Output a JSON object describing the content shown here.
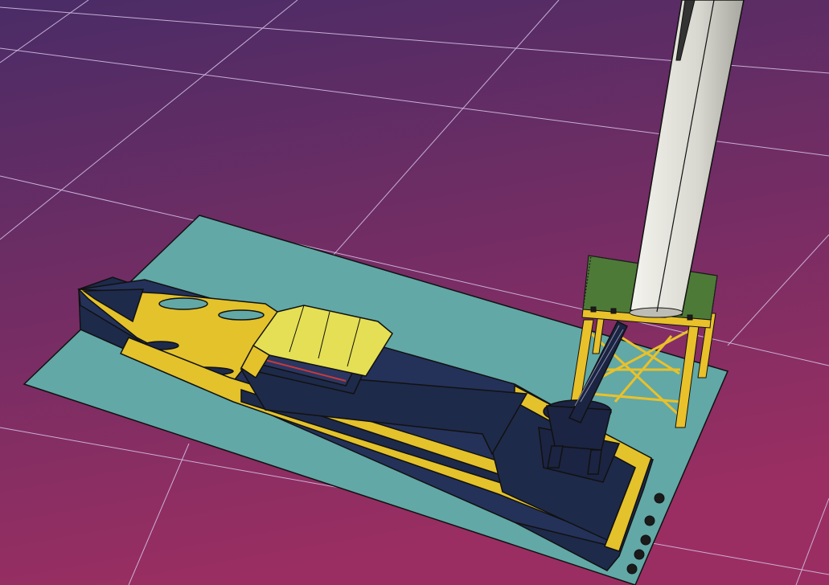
{
  "viewport": {
    "background_top": "#4a2c66",
    "background_bottom": "#9a2e62",
    "grid_color": "#d7c7ea"
  },
  "scene": {
    "model": "vessel-at-offshore-wind-turbine",
    "objects": [
      "sea-plane",
      "crew-transfer-vessel",
      "wheelhouse",
      "gangway-crane",
      "jacket-foundation",
      "turbine-tower",
      "propellers"
    ],
    "colors": {
      "sea": "#62a8a6",
      "hull": "#1e2a4a",
      "trim": "#e3c22c",
      "wheelhouse_roof": "#e5df55",
      "deck_green": "#4e7a38",
      "tower": "#dcdcd4",
      "outline": "#000000"
    }
  }
}
